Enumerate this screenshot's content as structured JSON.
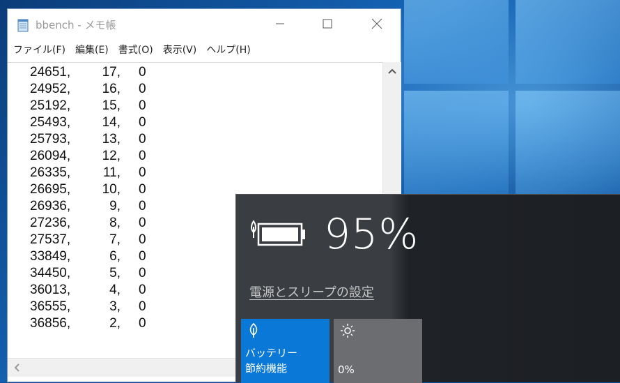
{
  "notepad": {
    "title": "bbench - メモ帳",
    "menu": [
      "ファイル(F)",
      "編集(E)",
      "書式(O)",
      "表示(V)",
      "ヘルプ(H)"
    ],
    "rows": [
      [
        "24651,",
        "17,",
        "0"
      ],
      [
        "24952,",
        "16,",
        "0"
      ],
      [
        "25192,",
        "15,",
        "0"
      ],
      [
        "25493,",
        "14,",
        "0"
      ],
      [
        "25793,",
        "13,",
        "0"
      ],
      [
        "26094,",
        "12,",
        "0"
      ],
      [
        "26335,",
        "11,",
        "0"
      ],
      [
        "26695,",
        "10,",
        "0"
      ],
      [
        "26936,",
        "9,",
        "0"
      ],
      [
        "27236,",
        "8,",
        "0"
      ],
      [
        "27537,",
        "7,",
        "0"
      ],
      [
        "33849,",
        "6,",
        "0"
      ],
      [
        "34450,",
        "5,",
        "0"
      ],
      [
        "36013,",
        "4,",
        "0"
      ],
      [
        "36555,",
        "3,",
        "0"
      ],
      [
        "36856,",
        "2,",
        "0"
      ]
    ],
    "highlight_color": "#e01010"
  },
  "battery": {
    "percent": "95%",
    "settings_link": "電源とスリープの設定",
    "saver_tile": {
      "line1": "バッテリー",
      "line2": "節約機能",
      "icon": "battery-saver-leaf-icon",
      "color": "#0a78d7"
    },
    "brightness_tile": {
      "value": "0%",
      "icon": "sun-icon"
    }
  }
}
